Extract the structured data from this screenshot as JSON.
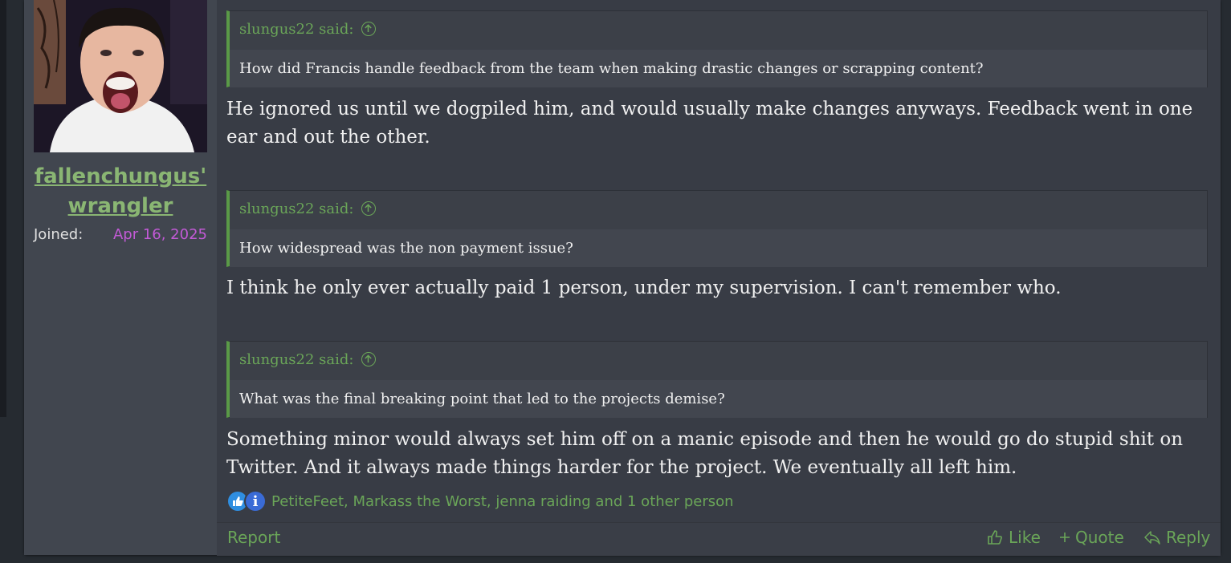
{
  "user": {
    "username_line1": "fallenchungus'",
    "username_line2": "wrangler",
    "joined_label": "Joined:",
    "joined_date": "Apr 16, 2025"
  },
  "quotes": [
    {
      "author": "slungus22 said:",
      "text": "How did Francis handle feedback from the team when making drastic changes or scrapping content?",
      "answer": "He ignored us until we dogpiled him, and would usually make changes anyways. Feedback went in one ear and out the other."
    },
    {
      "author": "slungus22 said:",
      "text": "How widespread was the non payment issue?",
      "answer": "I think he only ever actually paid 1 person, under my supervision. I can't remember who."
    },
    {
      "author": "slungus22 said:",
      "text": "What was the final breaking point that led to the projects demise?",
      "answer": "Something minor would always set him off on a manic episode and then he would go do stupid shit on Twitter. And it always made things harder for the project. We eventually all left him."
    }
  ],
  "reactions": {
    "text": "PetiteFeet, Markass the Worst, jenna raiding and 1 other person",
    "icons": [
      "thumbs-up-icon",
      "info-icon"
    ]
  },
  "footer": {
    "report": "Report",
    "like": "Like",
    "quote": "Quote",
    "reply": "Reply"
  },
  "colors": {
    "accent_green": "#6aa558",
    "username_green": "#8ab673",
    "joined_date": "#c25ad6",
    "post_bg": "#383c45",
    "sidebar_bg": "#41464f"
  }
}
